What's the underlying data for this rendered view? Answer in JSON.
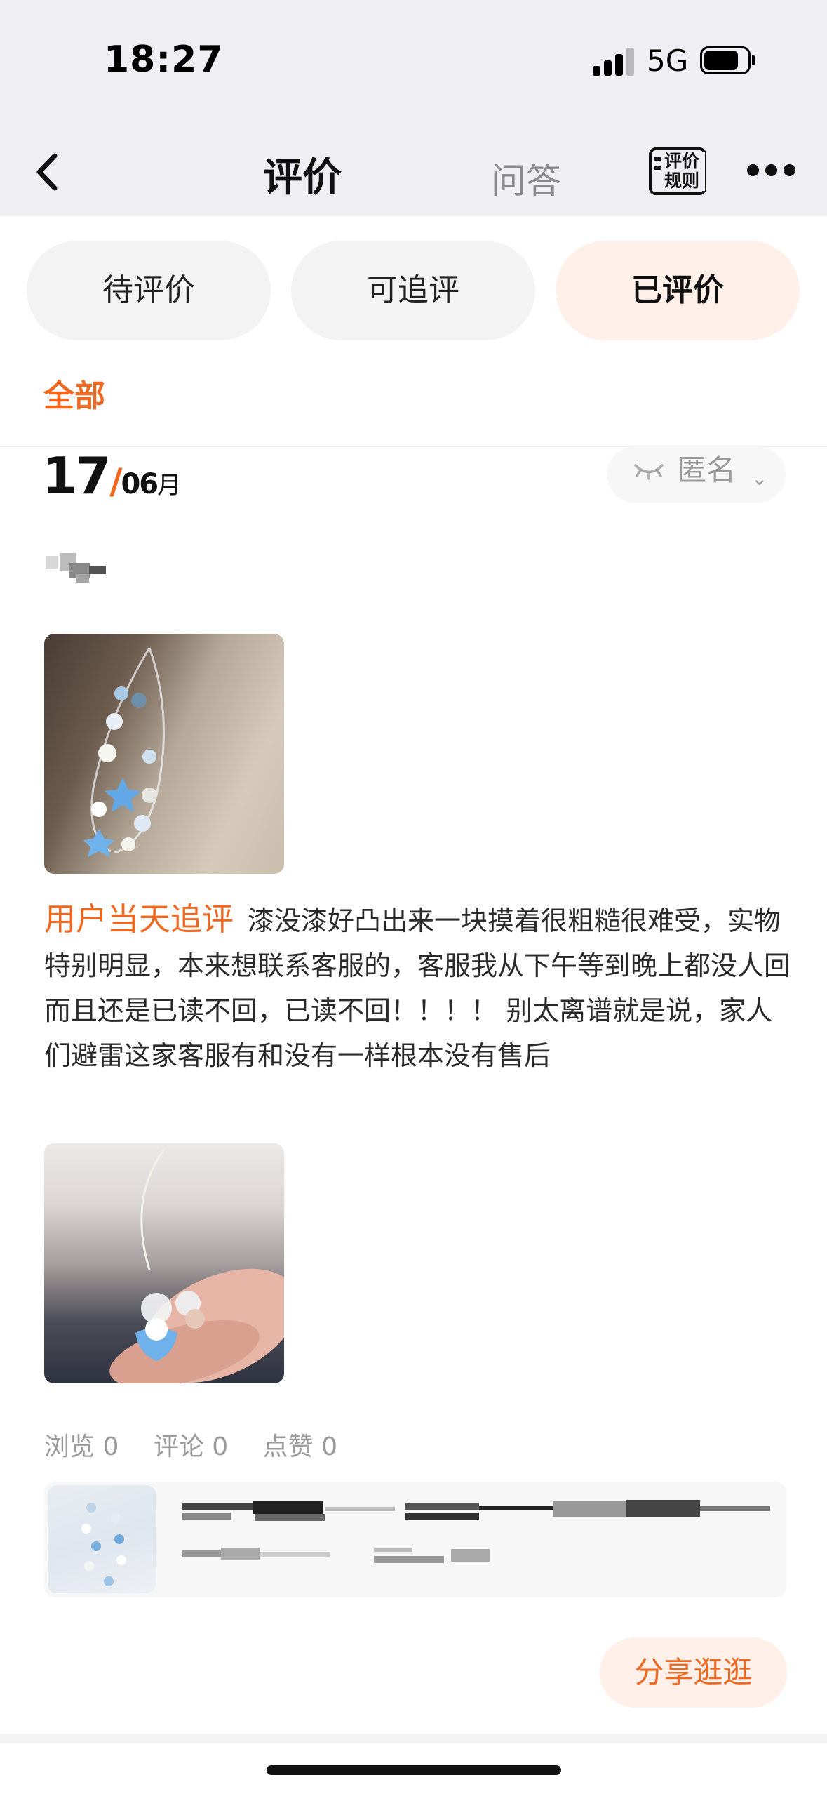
{
  "status_bar": {
    "time": "18:27",
    "network": "5G"
  },
  "nav": {
    "title": "评价",
    "qa_tab": "问答",
    "rules_label": "评价规则"
  },
  "filter_tabs": [
    {
      "label": "待评价",
      "active": false
    },
    {
      "label": "可追评",
      "active": false
    },
    {
      "label": "已评价",
      "active": true
    }
  ],
  "sub_filter": {
    "label": "全部"
  },
  "review": {
    "date_day": "17",
    "date_slash": "/",
    "date_month": "06",
    "date_month_unit": "月",
    "privacy": "匿名",
    "followup_tag": "用户当天追评",
    "followup_text": "漆没漆好凸出来一块摸着很粗糙很难受，实物特别明显，本来想联系客服的，客服我从下午等到晚上都没人回而且还是已读不回，已读不回！！！！ 别太离谱就是说，家人们避雷这家客服有和没有一样根本没有售后",
    "stats": {
      "views": "浏览 0",
      "comments": "评论 0",
      "likes": "点赞 0"
    },
    "share_label": "分享逛逛"
  },
  "colors": {
    "accent": "#f06820",
    "active_tab_bg": "#fff0ea",
    "nav_bg": "#efeef3"
  },
  "icons": [
    "back-icon",
    "rules-icon",
    "more-icon",
    "eye-closed-icon",
    "chevron-down-icon"
  ]
}
